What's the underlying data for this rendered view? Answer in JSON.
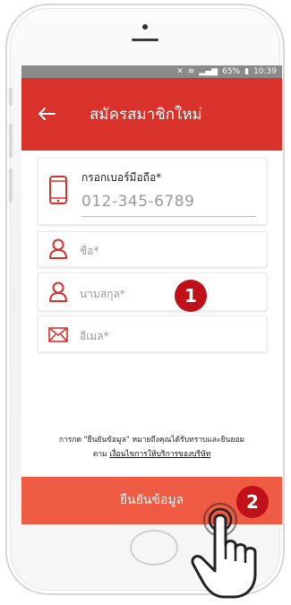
{
  "status_bar": {
    "battery": "65%",
    "time": "10:39"
  },
  "header": {
    "back_icon": "arrow-left-icon",
    "title": "สมัครสมาชิกใหม่",
    "color": "#d8322a"
  },
  "form": {
    "phone": {
      "icon": "phone-icon",
      "label": "กรอกเบอร์มือถือ*",
      "value": "012-345-6789"
    },
    "first_name": {
      "icon": "user-icon",
      "placeholder": "ชื่อ*"
    },
    "last_name": {
      "icon": "user-icon",
      "placeholder": "นามสกุล*"
    },
    "email": {
      "icon": "envelope-icon",
      "placeholder": "อีเมล*"
    }
  },
  "consent": {
    "line1": "การกด \"ยืนยันข้อมูล\" หมายถึงคุณได้รับทราบและยินยอม",
    "prefix": "ตาม",
    "link": "เงื่อนไขการให้บริการของบริษัท"
  },
  "submit": {
    "label": "ยืนยันข้อมูล",
    "color": "#ee5a42"
  },
  "annotations": {
    "step1": "1",
    "step2": "2",
    "badge_color": "#c0111a",
    "pointer_icon": "hand-pointer-icon"
  }
}
